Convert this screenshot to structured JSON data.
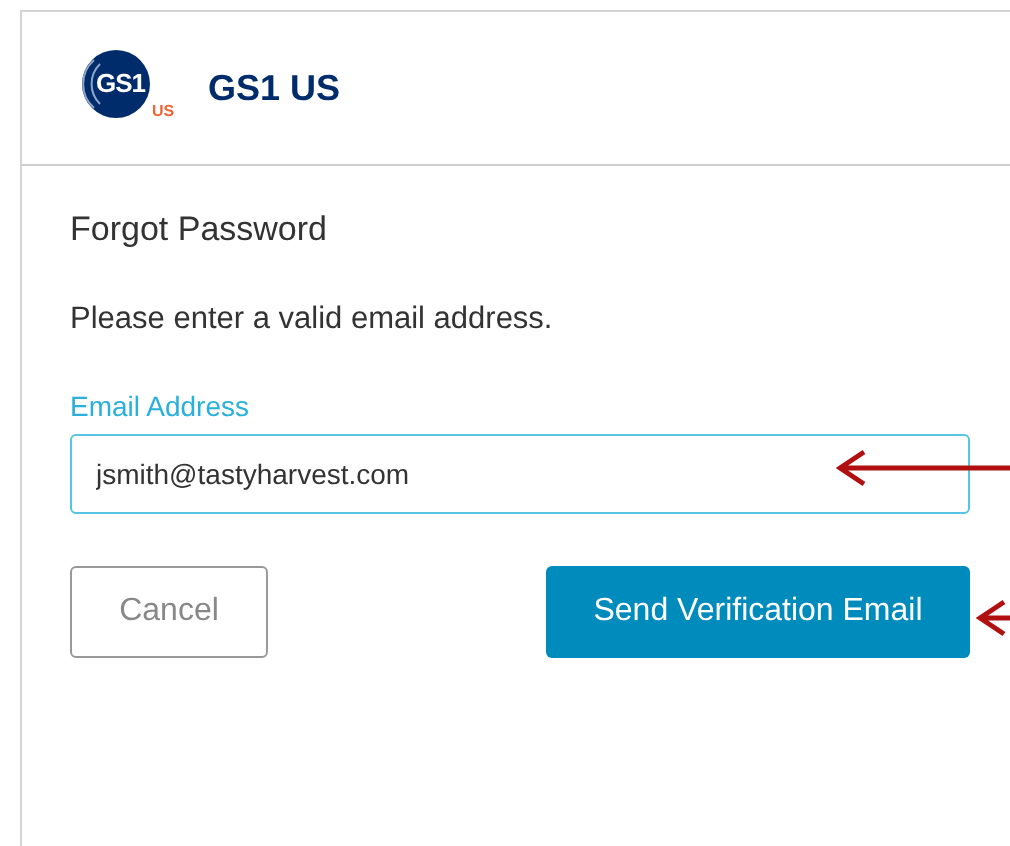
{
  "header": {
    "logo_mark": "GS1",
    "logo_region": "US",
    "brand": "GS1 US"
  },
  "form": {
    "title": "Forgot Password",
    "instruction": "Please enter a valid email address.",
    "field_label": "Email Address",
    "field_value": "jsmith@tastyharvest.com",
    "cancel": "Cancel",
    "submit": "Send Verification Email"
  }
}
